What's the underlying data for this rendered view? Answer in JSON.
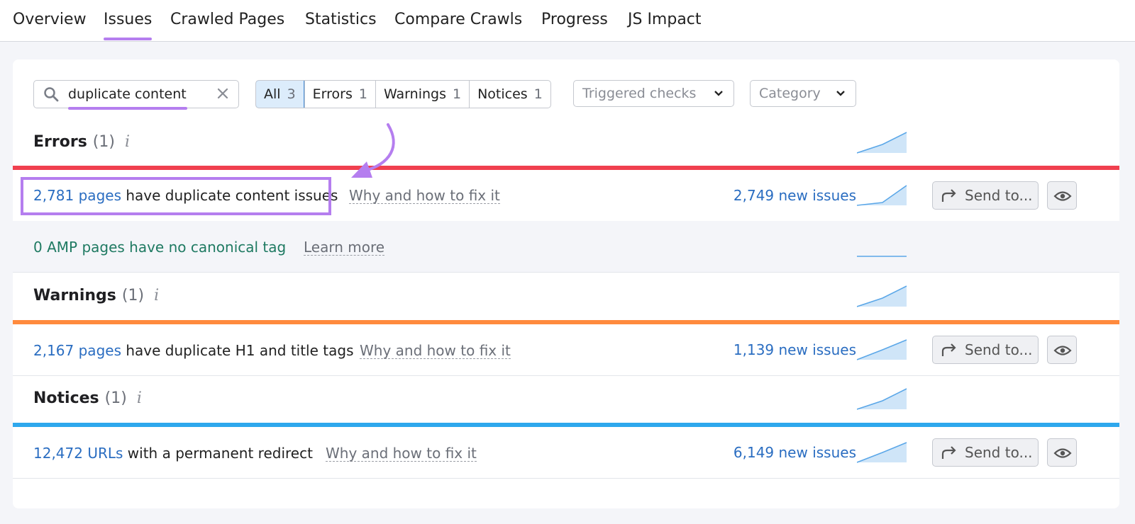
{
  "tabs": [
    "Overview",
    "Issues",
    "Crawled Pages",
    "Statistics",
    "Compare Crawls",
    "Progress",
    "JS Impact"
  ],
  "active_tab": "Issues",
  "search": {
    "value": "duplicate content",
    "icon": "search-icon",
    "clear_icon": "close-icon"
  },
  "filters": [
    {
      "label": "All",
      "count": "3",
      "selected": true
    },
    {
      "label": "Errors",
      "count": "1",
      "selected": false
    },
    {
      "label": "Warnings",
      "count": "1",
      "selected": false
    },
    {
      "label": "Notices",
      "count": "1",
      "selected": false
    }
  ],
  "dropdowns": {
    "triggered": "Triggered checks",
    "category": "Category"
  },
  "sections": {
    "errors": {
      "title": "Errors",
      "count": "(1)",
      "info": "i",
      "color": "#f0404f"
    },
    "warnings": {
      "title": "Warnings",
      "count": "(1)",
      "info": "i",
      "color": "#ff8a3d"
    },
    "notices": {
      "title": "Notices",
      "count": "(1)",
      "info": "i",
      "color": "#2ea8ed"
    }
  },
  "rows": {
    "dup_content": {
      "link": "2,781 pages",
      "text": " have duplicate content issues",
      "why": "Why and how to fix it",
      "new_issues": "2,749 new issues",
      "send": "Send to..."
    },
    "amp": {
      "text": "0 AMP pages have no canonical tag",
      "why": "Learn more"
    },
    "dup_h1": {
      "link": "2,167 pages",
      "text": " have duplicate H1 and title tags",
      "why": "Why and how to fix it",
      "new_issues": "1,139 new issues",
      "send": "Send to..."
    },
    "redirect": {
      "link": "12,472 URLs",
      "text": " with a permanent redirect",
      "why": "Why and how to fix it",
      "new_issues": "6,149 new issues",
      "send": "Send to..."
    }
  },
  "colors": {
    "accent_purple": "#b57eef",
    "link_blue": "#2a6dc1",
    "amp_green": "#1f7a62",
    "spark_fill": "#cfe5f8",
    "spark_line": "#5ba7e8"
  }
}
